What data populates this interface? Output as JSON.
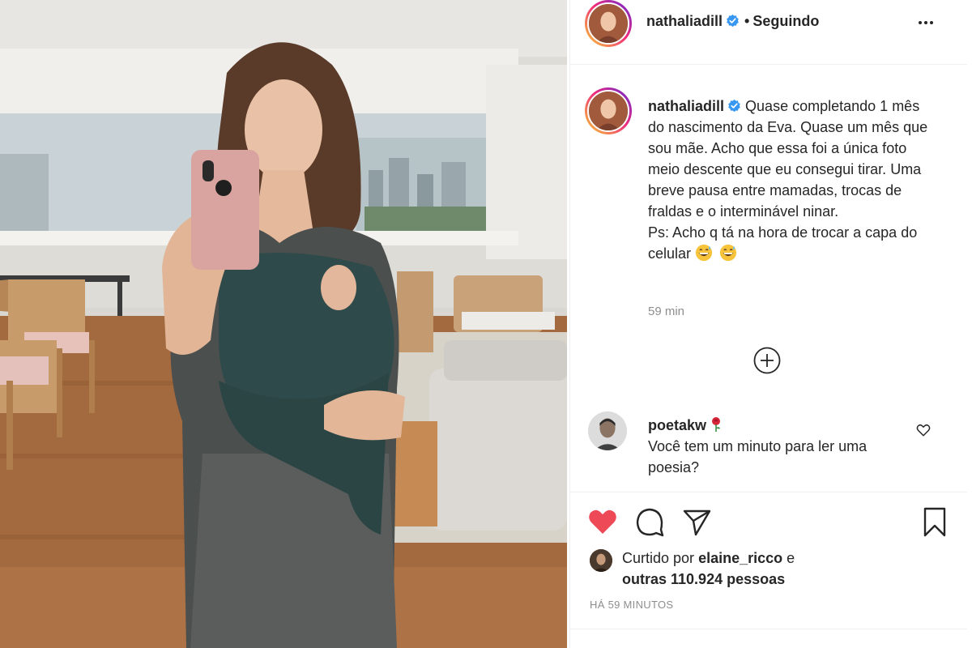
{
  "post": {
    "username": "nathaliadill",
    "follow_status": "Seguindo",
    "separator": "•",
    "caption_lines": [
      "Quase completando 1",
      "mês do nascimento da Eva. Quase um mês que sou mãe. Acho que essa foi a única foto meio descente que eu consegui tirar. Uma breve pausa entre mamadas, trocas de fraldas e o interminável ninar.",
      "Ps: Acho q tá na hora de trocar a capa do celular"
    ],
    "caption_emoji": [
      "grinning-sweat-emoji",
      "grinning-sweat-emoji"
    ],
    "caption_time": "59 min"
  },
  "comment": {
    "username": "poetakw",
    "user_emoji": "rose-emoji",
    "text": "Você tem um minuto para ler uma poesia?"
  },
  "likes": {
    "prefix": "Curtido por",
    "liker": "elaine_ricco",
    "connector": "e",
    "others": "outras 110.924 pessoas"
  },
  "timestamp": "HÁ 59 MINUTOS",
  "icons": {
    "like": "heart-filled-icon",
    "comment": "comment-icon",
    "share": "paper-plane-icon",
    "save": "bookmark-icon",
    "more": "more-options-icon",
    "load_more": "plus-circle-icon",
    "verified": "verified-badge-icon",
    "comment_like": "heart-outline-icon"
  },
  "colors": {
    "like_red": "#ed4956",
    "verified_blue": "#3897f0",
    "muted": "#8e8e8e",
    "text": "#262626"
  }
}
